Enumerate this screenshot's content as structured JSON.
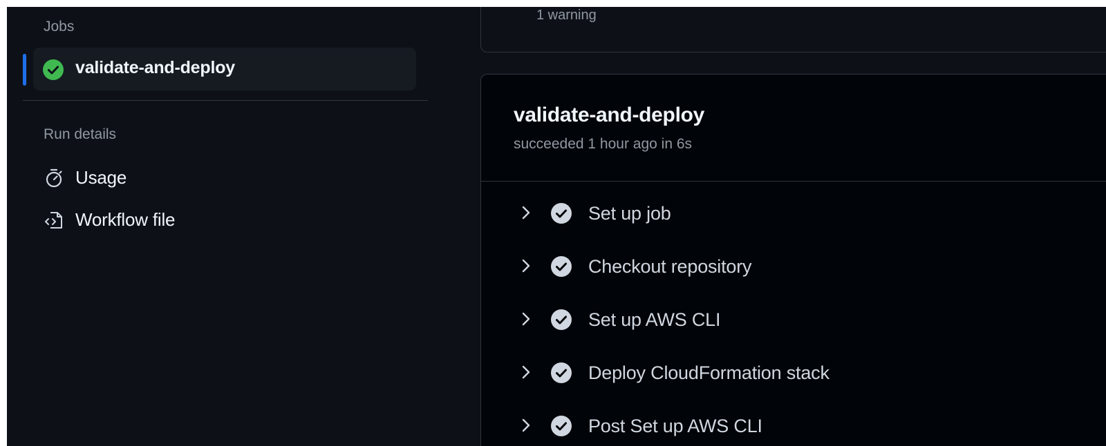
{
  "sidebar": {
    "jobs_label": "Jobs",
    "job": {
      "name": "validate-and-deploy",
      "status_icon": "check-circle-fill-icon",
      "status_color": "#3fb950"
    },
    "run_details_label": "Run details",
    "items": [
      {
        "label": "Usage",
        "icon": "stopwatch-icon"
      },
      {
        "label": "Workflow file",
        "icon": "file-code-icon"
      }
    ]
  },
  "summary": {
    "warning_text": "1 warning"
  },
  "job_panel": {
    "title": "validate-and-deploy",
    "subtitle": "succeeded 1 hour ago in 6s",
    "steps": [
      {
        "label": "Set up job",
        "icon": "check-circle-icon"
      },
      {
        "label": "Checkout repository",
        "icon": "check-circle-icon"
      },
      {
        "label": "Set up AWS CLI",
        "icon": "check-circle-icon"
      },
      {
        "label": "Deploy CloudFormation stack",
        "icon": "check-circle-icon"
      },
      {
        "label": "Post Set up AWS CLI",
        "icon": "check-circle-icon"
      }
    ]
  },
  "colors": {
    "background": "#0d1117",
    "panel": "#010409",
    "accent": "#1f6feb",
    "success": "#3fb950",
    "text_primary": "#f0f6fc",
    "text_muted": "#9198a1"
  }
}
